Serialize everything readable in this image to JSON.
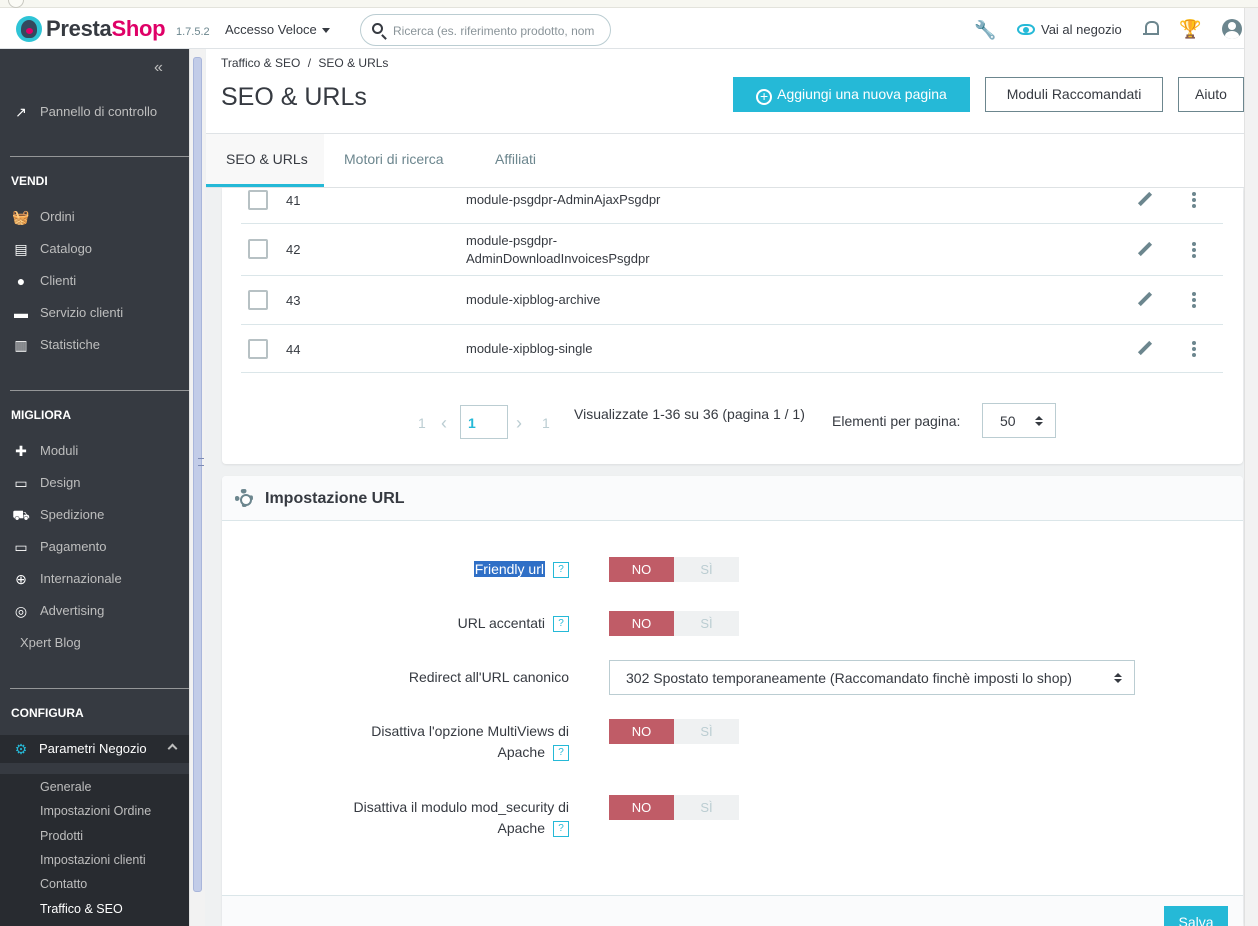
{
  "header": {
    "brand_presta": "Presta",
    "brand_shop": "Shop",
    "version": "1.7.5.2",
    "quick_access": "Accesso Veloce",
    "search_placeholder": "Ricerca (es. riferimento prodotto, nom",
    "view_shop": "Vai al negozio"
  },
  "sidebar": {
    "dashboard": "Pannello di controllo",
    "sell_title": "VENDI",
    "sell_items": [
      "Ordini",
      "Catalogo",
      "Clienti",
      "Servizio clienti",
      "Statistiche"
    ],
    "improve_title": "MIGLIORA",
    "improve_items": [
      "Moduli",
      "Design",
      "Spedizione",
      "Pagamento",
      "Internazionale",
      "Advertising",
      "Xpert Blog"
    ],
    "configure_title": "CONFIGURA",
    "shop_params": "Parametri Negozio",
    "sub_items": [
      "Generale",
      "Impostazioni Ordine",
      "Prodotti",
      "Impostazioni clienti",
      "Contatto",
      "Traffico & SEO"
    ]
  },
  "page": {
    "breadcrumb_parent": "Traffico & SEO",
    "breadcrumb_sep": "/",
    "breadcrumb_current": "SEO & URLs",
    "title": "SEO & URLs",
    "btn_add": "Aggiungi una nuova pagina",
    "btn_modules": "Moduli Raccomandati",
    "btn_help": "Aiuto",
    "tabs": [
      "SEO & URLs",
      "Motori di ricerca",
      "Affiliati"
    ]
  },
  "table": {
    "rows": [
      {
        "id": "41",
        "name": "module-psgdpr-AdminAjaxPsgdpr"
      },
      {
        "id": "42",
        "name": "module-psgdpr-",
        "name2": "AdminDownloadInvoicesPsgdpr"
      },
      {
        "id": "43",
        "name": "module-xipblog-archive"
      },
      {
        "id": "44",
        "name": "module-xipblog-single"
      }
    ],
    "pager_first": "1",
    "pager_current": "1",
    "pager_last": "1",
    "pager_info": "Visualizzate 1-36 su 36 (pagina 1 / 1)",
    "per_page_label": "Elementi per pagina:",
    "per_page_value": "50"
  },
  "url_settings": {
    "title": "Impostazione URL",
    "friendly_url": "Friendly url",
    "accented_url": "URL accentati",
    "redirect_label": "Redirect all'URL canonico",
    "redirect_value": "302 Spostato temporaneamente (Raccomandato finchè imposti lo shop)",
    "multiviews_line1": "Disattiva l'opzione MultiViews di",
    "multiviews_line2": "Apache",
    "modsec_line1": "Disattiva il modulo mod_security di",
    "modsec_line2": "Apache",
    "no": "NO",
    "si": "SÌ",
    "help": "?",
    "save": "Salva"
  },
  "colors": {
    "accent": "#25b9d7",
    "sidebar_bg": "#363a41",
    "toggle_no": "#c05c67"
  }
}
